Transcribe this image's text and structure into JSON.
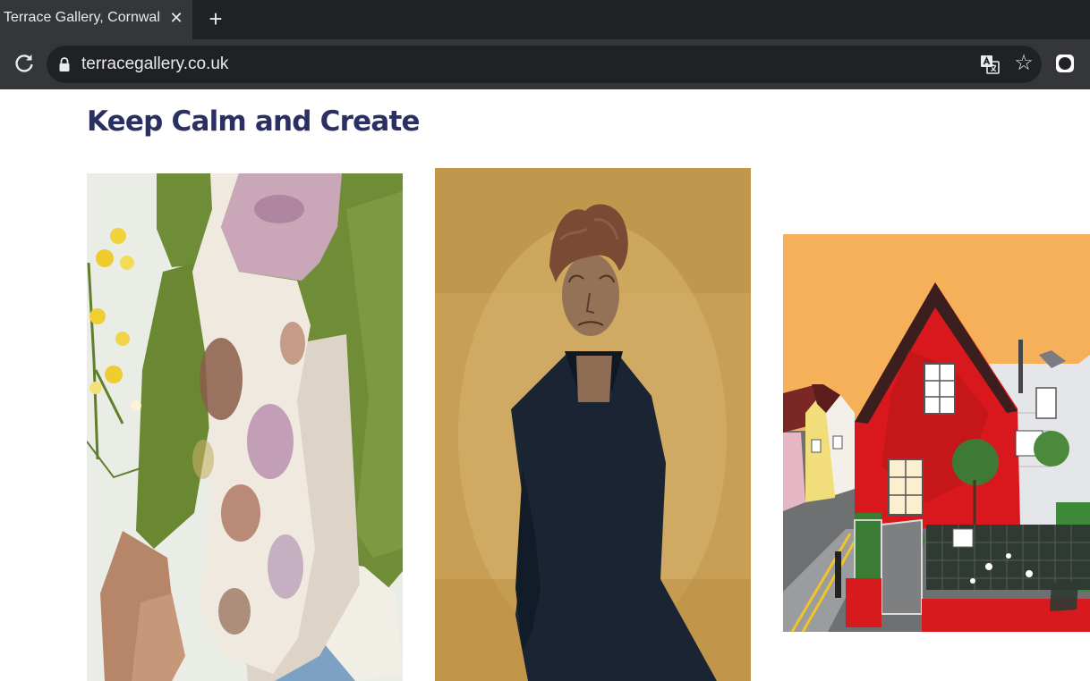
{
  "browser": {
    "tab": {
      "title": "Terrace Gallery, Cornwall UK",
      "close_glyph": "✕"
    },
    "new_tab_glyph": "+",
    "address_bar": {
      "url": "terracegallery.co.uk"
    },
    "bookmark_glyph": "☆",
    "icons": [
      "reload-icon",
      "lock-icon",
      "translate-icon",
      "bookmark-star-icon",
      "extension-icon"
    ]
  },
  "page": {
    "heading": "Keep Calm and Create",
    "artworks": [
      {
        "subject": "scarf-photo"
      },
      {
        "subject": "portrait-painting"
      },
      {
        "subject": "red-house-painting"
      }
    ]
  }
}
